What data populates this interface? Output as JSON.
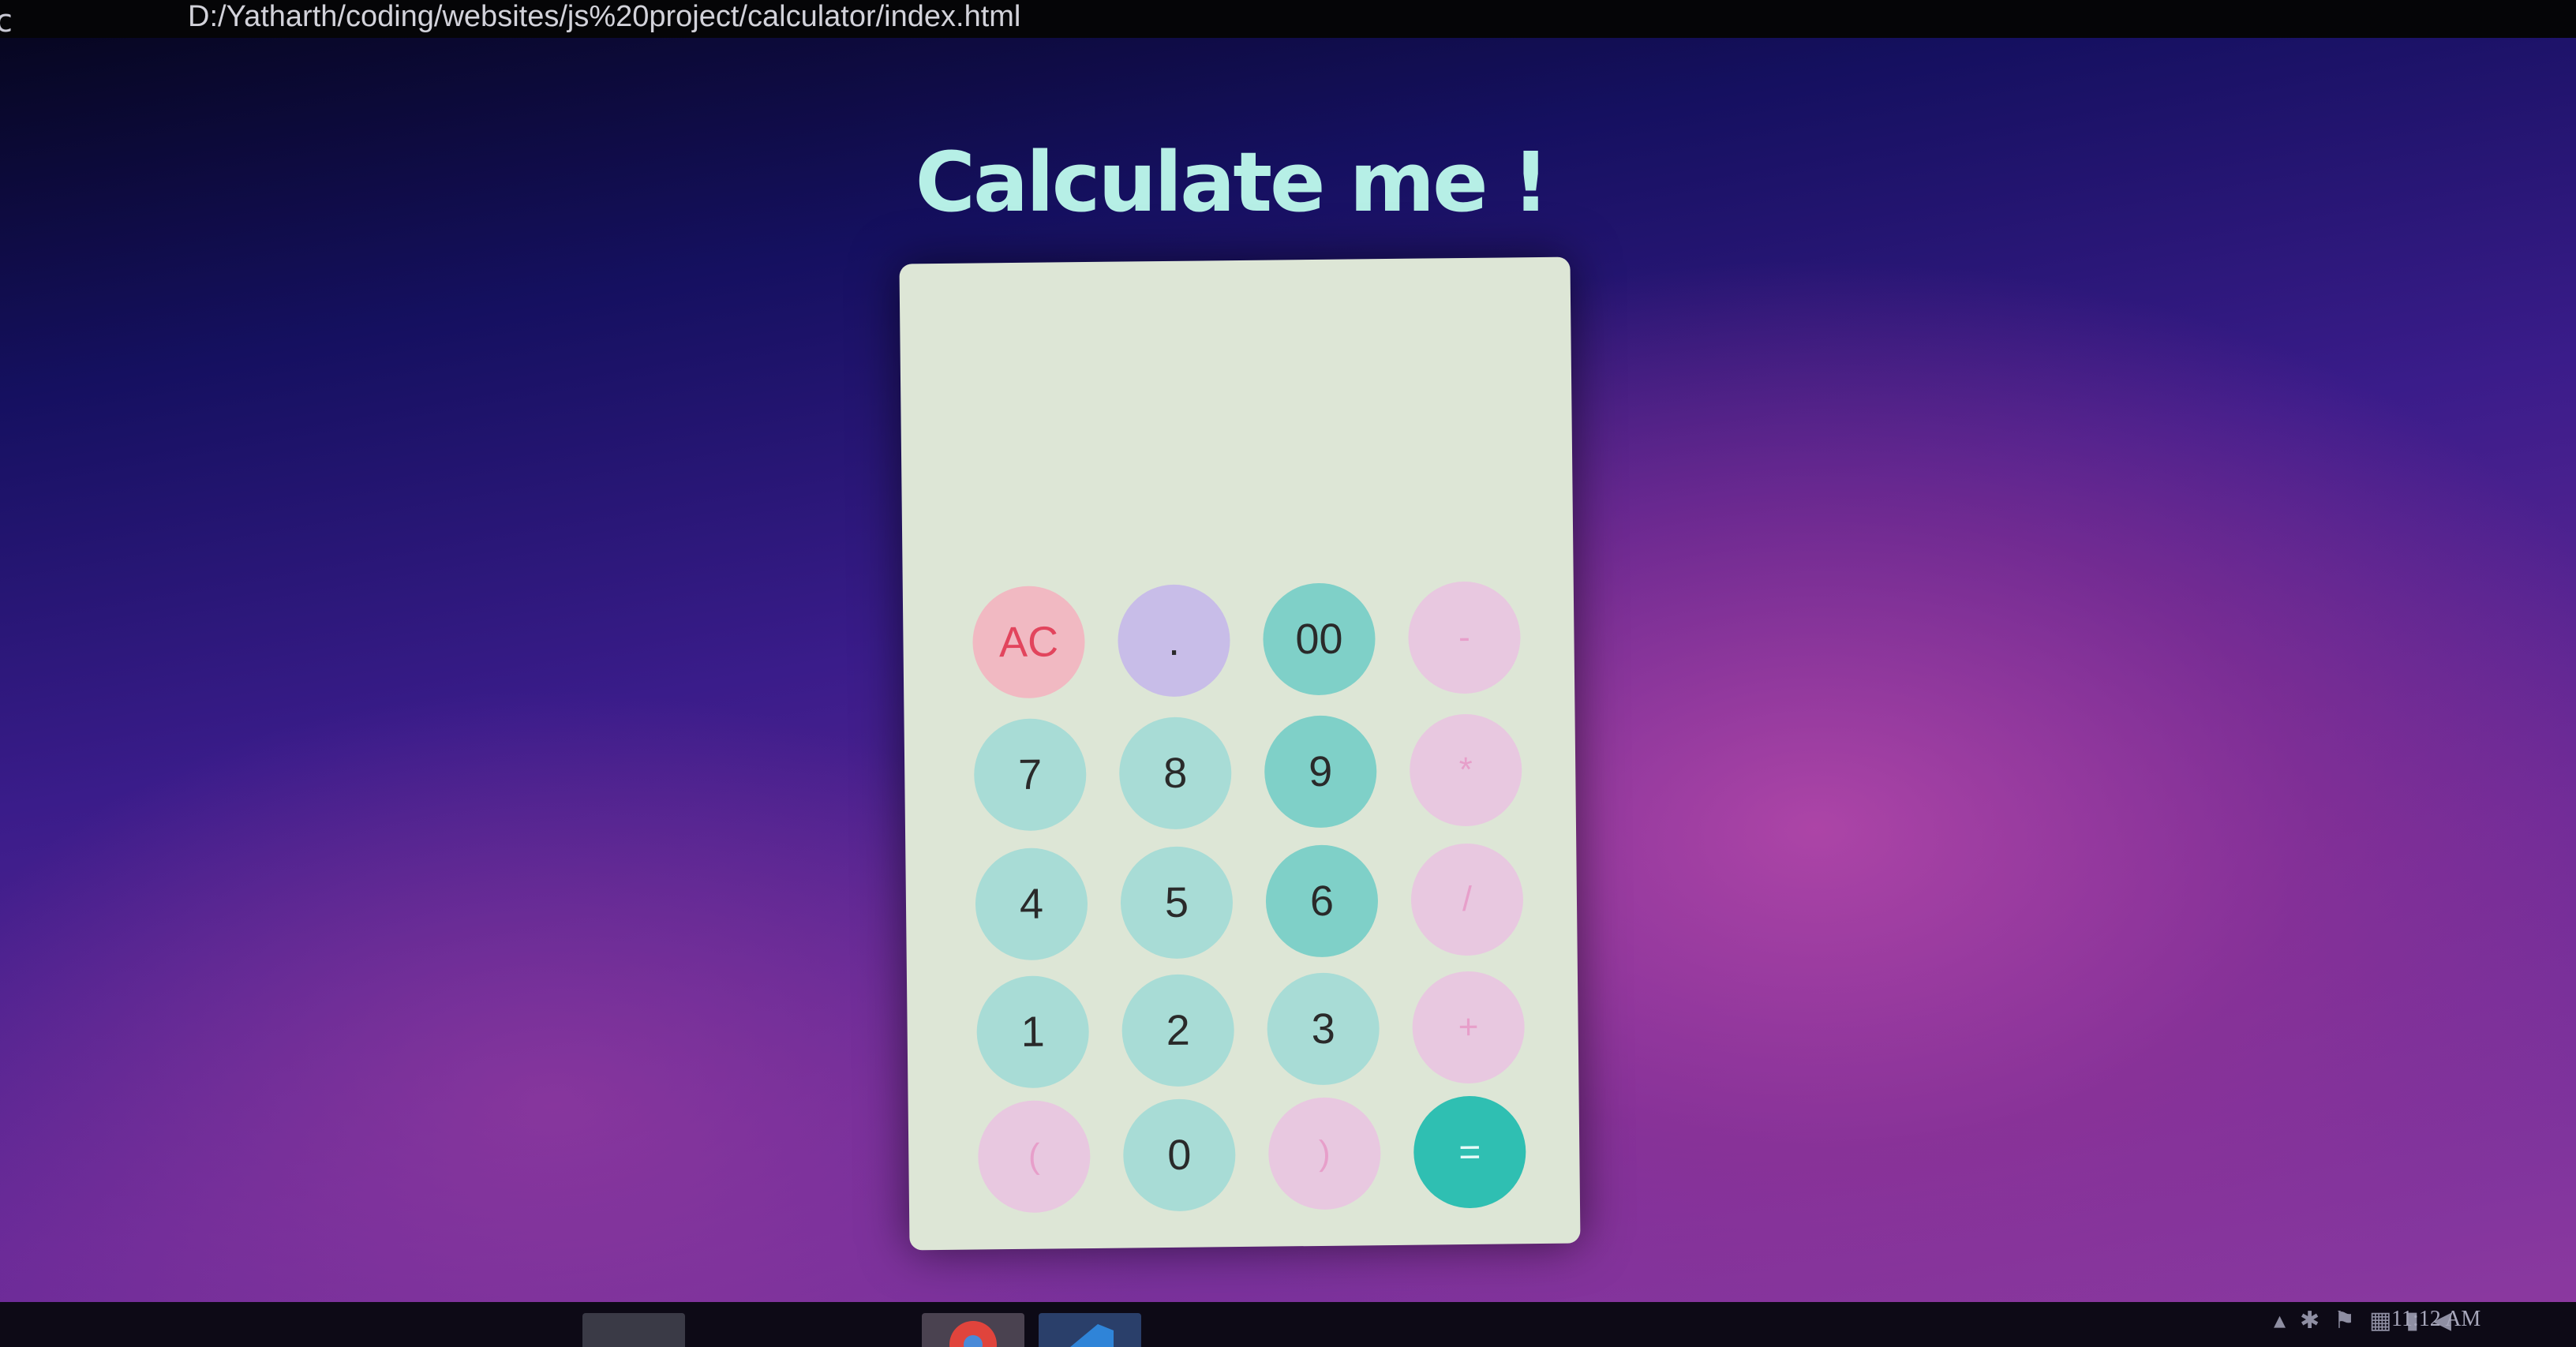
{
  "browser": {
    "back_icon": "back-icon",
    "url": "D:/Yatharth/coding/websites/js%20project/calculator/index.html"
  },
  "page": {
    "title": "Calculate me !"
  },
  "calculator": {
    "display_value": "",
    "keys": {
      "ac": "AC",
      "dot": ".",
      "double_zero": "00",
      "minus": "-",
      "seven": "7",
      "eight": "8",
      "nine": "9",
      "multiply": "*",
      "four": "4",
      "five": "5",
      "six": "6",
      "divide": "/",
      "one": "1",
      "two": "2",
      "three": "3",
      "plus": "+",
      "open_paren": "(",
      "zero": "0",
      "close_paren": ")",
      "equals": "="
    }
  },
  "taskbar": {
    "apps": [
      "folder-icon",
      "chrome-icon",
      "vscode-icon"
    ],
    "clock": "11:12 AM"
  },
  "colors": {
    "title": "#b6efe6",
    "calculator_bg": "#dde6d6",
    "number_key": "#a8dcd6",
    "operator_key": "#e8c8e0",
    "ac_key": "#f1b9c2",
    "equals_key": "#2fbfb2"
  }
}
